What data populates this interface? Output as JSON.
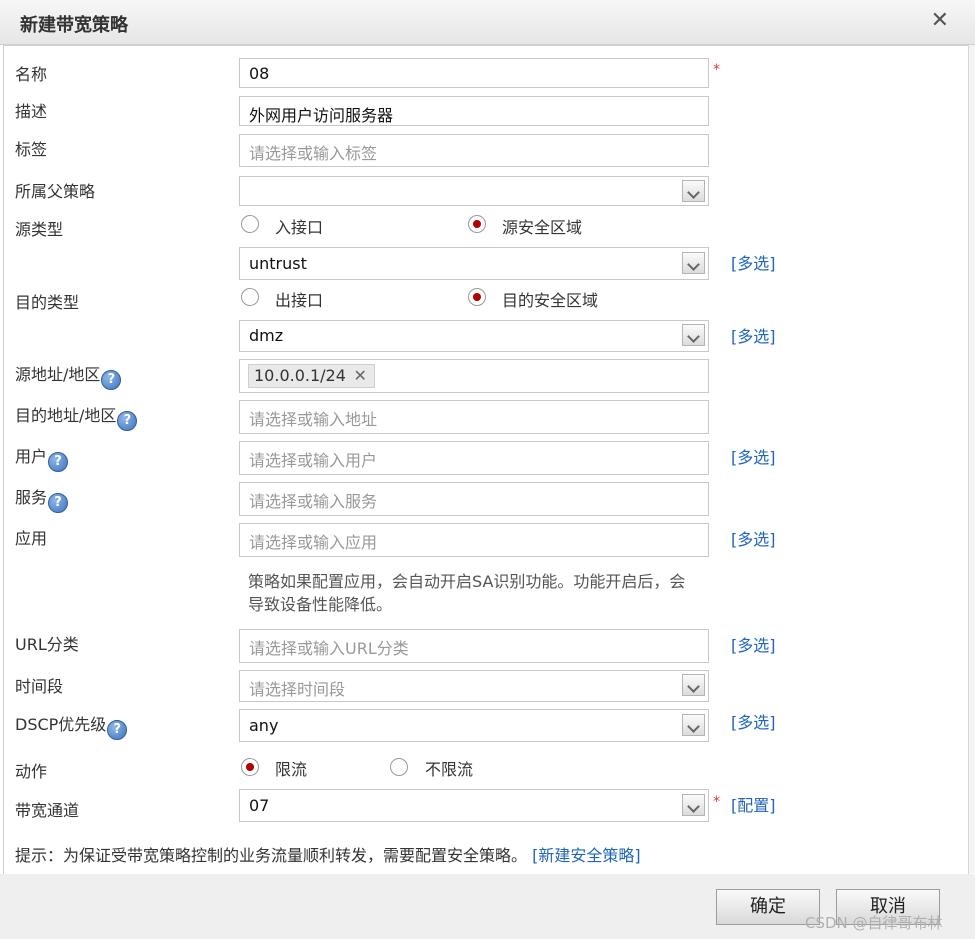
{
  "dialog": {
    "title": "新建带宽策略",
    "close_label": "✕"
  },
  "form": {
    "name": {
      "label": "名称",
      "value": "08",
      "required": "*"
    },
    "description": {
      "label": "描述",
      "value": "外网用户访问服务器"
    },
    "tag": {
      "label": "标签",
      "placeholder": "请选择或输入标签"
    },
    "parent_policy": {
      "label": "所属父策略",
      "value": ""
    },
    "source_type": {
      "label": "源类型",
      "options": [
        "入接口",
        "源安全区域"
      ],
      "selected": "源安全区域",
      "zone_value": "untrust",
      "multi_link": "[多选]"
    },
    "dest_type": {
      "label": "目的类型",
      "options": [
        "出接口",
        "目的安全区域"
      ],
      "selected": "目的安全区域",
      "zone_value": "dmz",
      "multi_link": "[多选]"
    },
    "source_address": {
      "label": "源地址/地区",
      "help": "?",
      "tags": [
        "10.0.0.1/24"
      ],
      "tag_remove": "✕"
    },
    "dest_address": {
      "label": "目的地址/地区",
      "help": "?",
      "placeholder": "请选择或输入地址"
    },
    "user": {
      "label": "用户",
      "help": "?",
      "placeholder": "请选择或输入用户",
      "multi_link": "[多选]"
    },
    "service": {
      "label": "服务",
      "help": "?",
      "placeholder": "请选择或输入服务"
    },
    "application": {
      "label": "应用",
      "placeholder": "请选择或输入应用",
      "multi_link": "[多选]",
      "note": "策略如果配置应用，会自动开启SA识别功能。功能开启后，会导致设备性能降低。"
    },
    "url_category": {
      "label": "URL分类",
      "placeholder": "请选择或输入URL分类",
      "multi_link": "[多选]"
    },
    "time_range": {
      "label": "时间段",
      "placeholder": "请选择时间段"
    },
    "dscp": {
      "label": "DSCP优先级",
      "help": "?",
      "value": "any",
      "multi_link": "[多选]"
    },
    "action": {
      "label": "动作",
      "options": [
        "限流",
        "不限流"
      ],
      "selected": "限流"
    },
    "bandwidth_channel": {
      "label": "带宽通道",
      "value": "07",
      "required": "*",
      "config_link": "[配置]"
    }
  },
  "hint": {
    "text": "提示：为保证受带宽策略控制的业务流量顺利转发，需要配置安全策略。",
    "link": "[新建安全策略]"
  },
  "buttons": {
    "ok": "确定",
    "cancel": "取消"
  },
  "watermark": "CSDN @自律哥布林"
}
